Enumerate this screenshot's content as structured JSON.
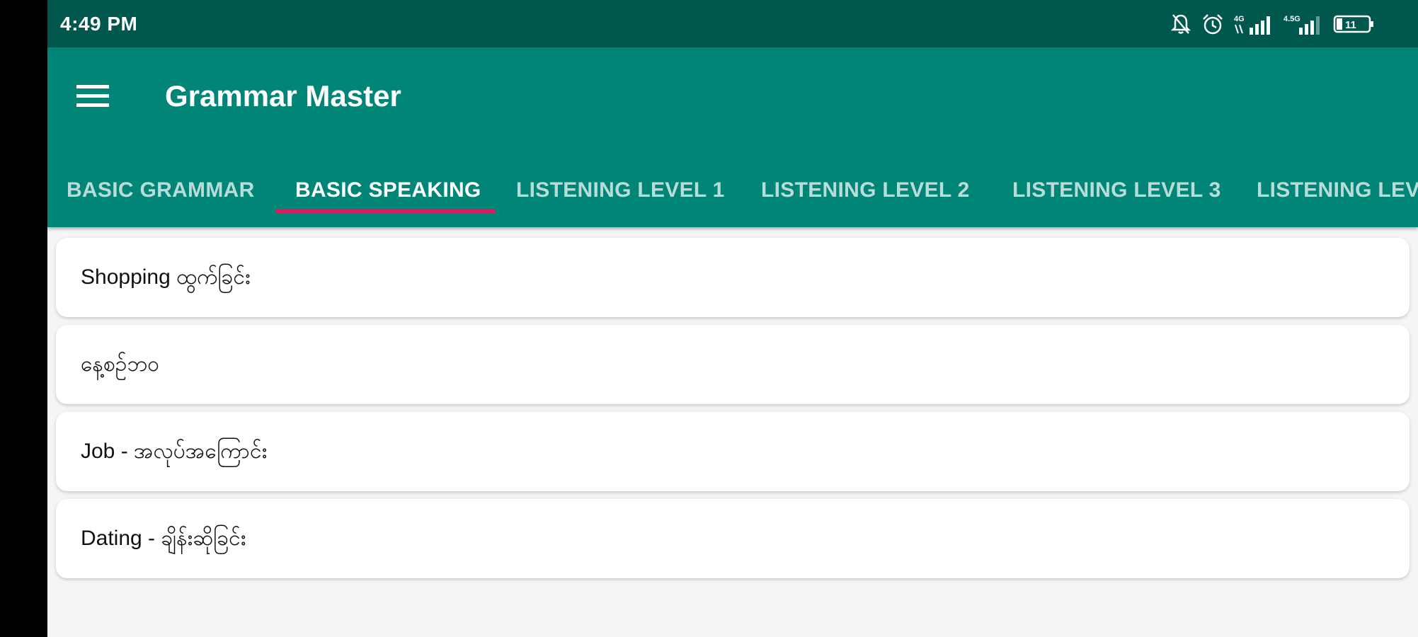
{
  "status_bar": {
    "time": "4:49 PM",
    "icons": [
      "mute-icon",
      "alarm-icon",
      "signal-4g-icon",
      "signal-4-5g-icon",
      "battery-icon"
    ],
    "battery_level": "11"
  },
  "app_bar": {
    "title": "Grammar Master",
    "menu_icon": "hamburger-menu-icon"
  },
  "tabs": [
    {
      "label": "BASIC GRAMMAR",
      "active": false
    },
    {
      "label": "BASIC SPEAKING",
      "active": true
    },
    {
      "label": "LISTENING LEVEL 1",
      "active": false
    },
    {
      "label": "LISTENING LEVEL 2",
      "active": false
    },
    {
      "label": "LISTENING LEVEL 3",
      "active": false
    },
    {
      "label": "LISTENING LEV",
      "active": false
    }
  ],
  "list_items": [
    {
      "label": "Shopping ထွက်ခြင်း"
    },
    {
      "label": "နေ့စဥ်ဘဝ"
    },
    {
      "label": "Job - အလုပ်အကြောင်း"
    },
    {
      "label": "Dating - ချိန်းဆိုခြင်း"
    }
  ],
  "colors": {
    "status_bar": "#00574d",
    "app_bar": "#008577",
    "tab_indicator": "#d81b60",
    "background": "#f5f5f5"
  }
}
